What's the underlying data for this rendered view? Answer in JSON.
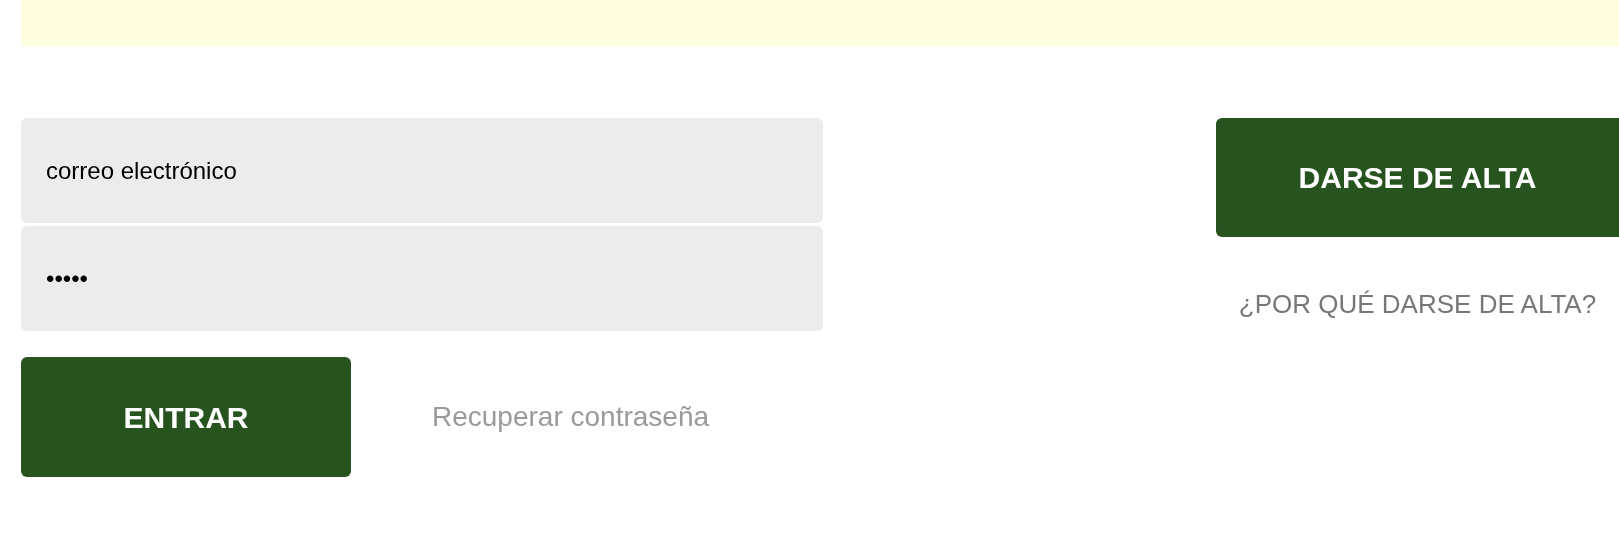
{
  "login": {
    "email_field": {
      "placeholder": "correo electrónico"
    },
    "password_field": {
      "value": "•••••"
    },
    "submit_button": "ENTRAR",
    "recover_link": "Recuperar contraseña"
  },
  "signup": {
    "button": "DARSE DE ALTA",
    "why_link": "¿POR QUÉ DARSE DE ALTA?"
  }
}
